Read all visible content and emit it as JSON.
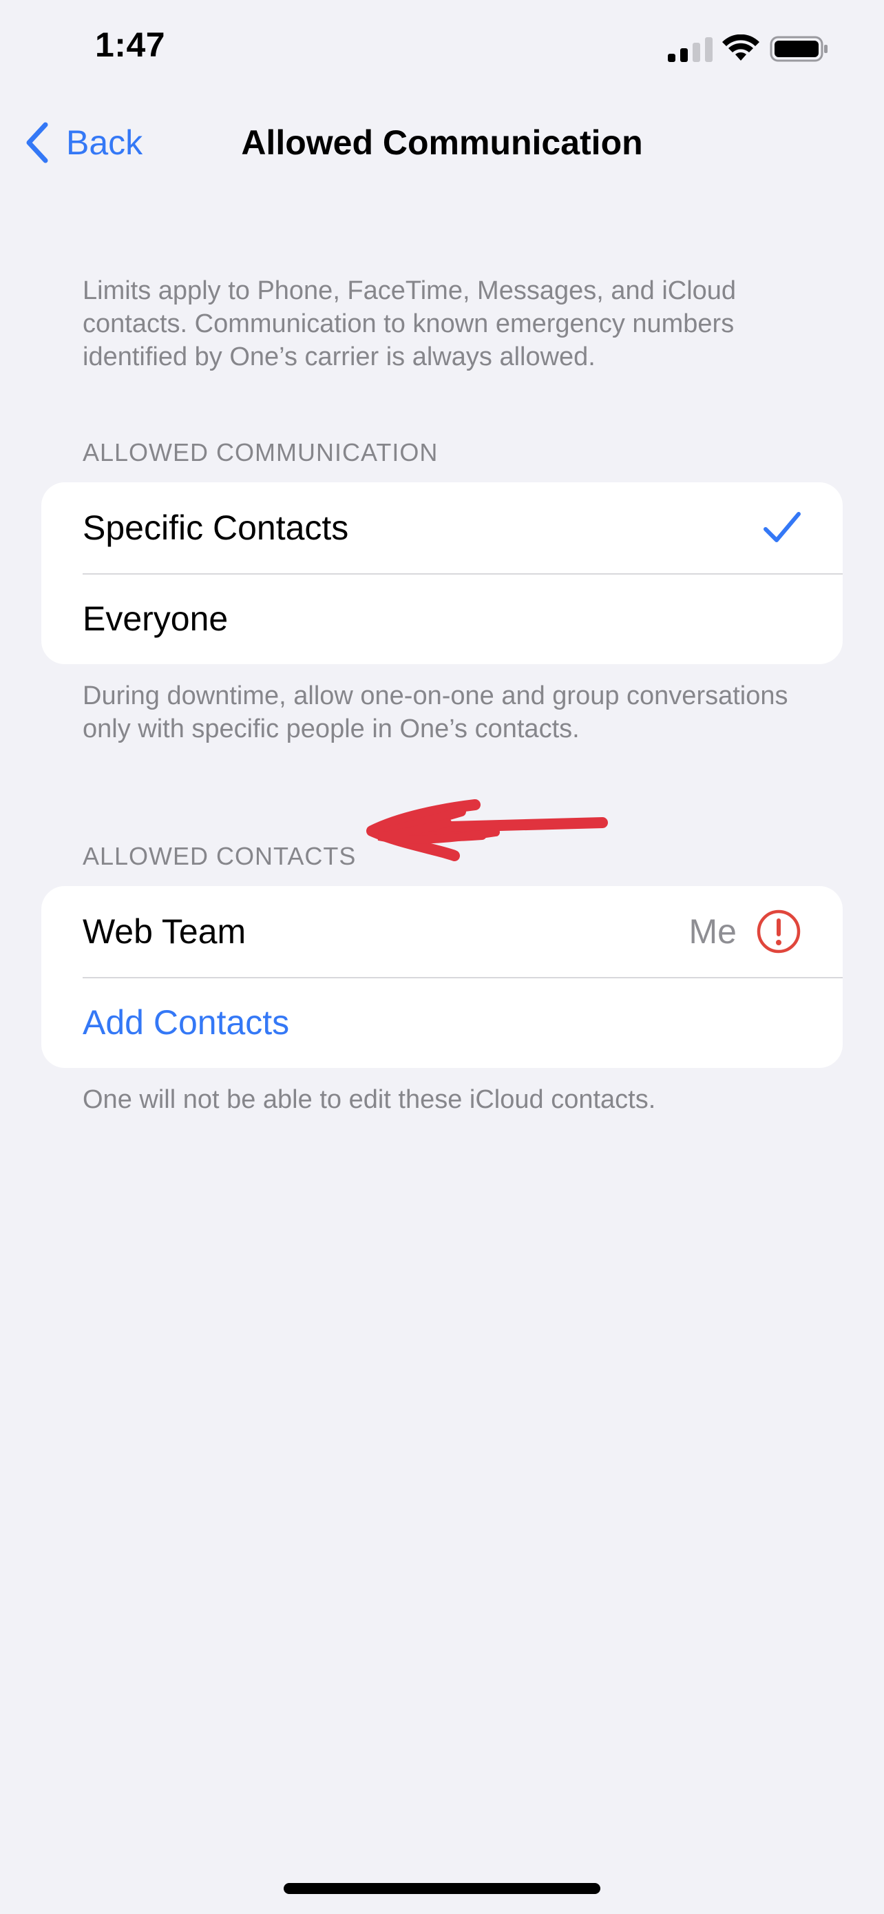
{
  "status_bar": {
    "time": "1:47"
  },
  "nav": {
    "back_label": "Back",
    "title": "Allowed Communication"
  },
  "intro_footnote": "Limits apply to Phone, FaceTime, Messages, and iCloud contacts. Communication to known emergency numbers identified by One’s carrier is always allowed.",
  "allowed_communication": {
    "header": "ALLOWED COMMUNICATION",
    "options": [
      {
        "label": "Specific Contacts",
        "selected": true
      },
      {
        "label": "Everyone",
        "selected": false
      }
    ],
    "footer": "During downtime, allow one-on-one and group conversations only with specific people in One’s contacts."
  },
  "allowed_contacts": {
    "header": "ALLOWED CONTACTS",
    "contacts": [
      {
        "name": "Web Team",
        "detail": "Me",
        "status_icon": "exclamation-circle-icon"
      }
    ],
    "add_label": "Add Contacts",
    "footer": "One will not be able to edit these iCloud contacts."
  },
  "colors": {
    "accent": "#3478f6",
    "background": "#f2f2f7",
    "secondary_text": "#86868b",
    "alert": "#e0463c",
    "annotation": "#e0333e"
  }
}
